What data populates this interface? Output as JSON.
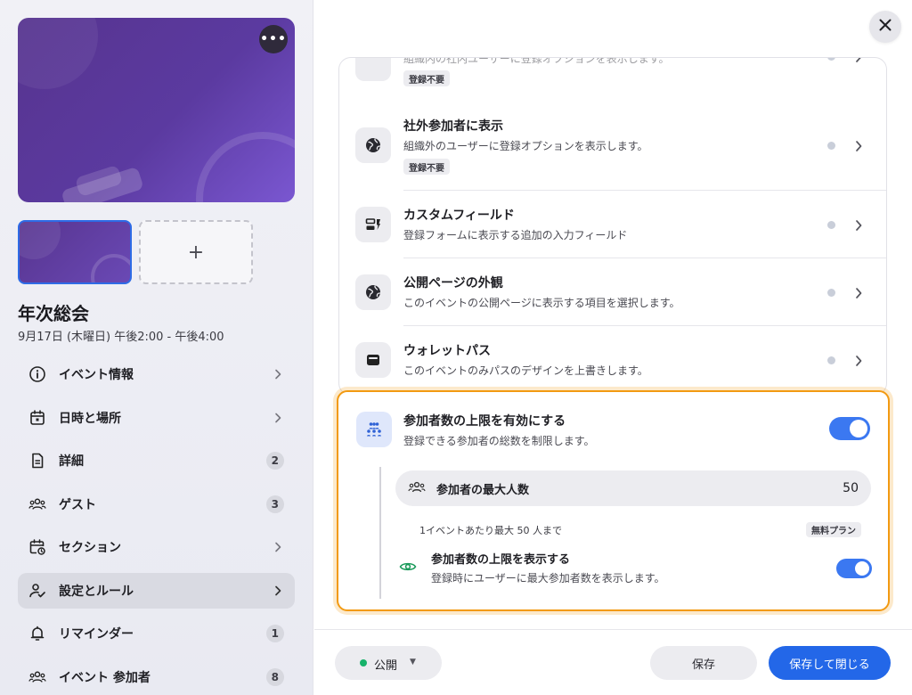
{
  "event": {
    "title": "年次総会",
    "date": "9月17日 (木曜日) 午後2:00 - 午後4:00",
    "add_thumb": "+",
    "more": "•••"
  },
  "nav": [
    {
      "label": "イベント情報",
      "icon": "info-icon",
      "trail": "chevron"
    },
    {
      "label": "日時と場所",
      "icon": "calendar-icon",
      "trail": "chevron"
    },
    {
      "label": "詳細",
      "icon": "document-icon",
      "trail": "badge",
      "badge": "2"
    },
    {
      "label": "ゲスト",
      "icon": "people-icon",
      "trail": "badge",
      "badge": "3"
    },
    {
      "label": "セクション",
      "icon": "calendar-clock-icon",
      "trail": "chevron"
    },
    {
      "label": "設定とルール",
      "icon": "person-check-icon",
      "trail": "chevron",
      "active": true
    },
    {
      "label": "リマインダー",
      "icon": "bell-icon",
      "trail": "badge",
      "badge": "1"
    },
    {
      "label": "イベント 参加者",
      "icon": "group-icon",
      "trail": "badge",
      "badge": "8"
    }
  ],
  "settings": {
    "partial_row": {
      "desc": "組織内の社内ユーザーに登録オプションを表示します。",
      "tag": "登録不要"
    },
    "rows": [
      {
        "title": "社外参加者に表示",
        "desc": "組織外のユーザーに登録オプションを表示します。",
        "tag": "登録不要",
        "icon": "globe-icon"
      },
      {
        "title": "カスタムフィールド",
        "desc": "登録フォームに表示する追加の入力フィールド",
        "icon": "form-fields-icon"
      },
      {
        "title": "公開ページの外観",
        "desc": "このイベントの公開ページに表示する項目を選択します。",
        "icon": "globe-icon"
      },
      {
        "title": "ウォレットパス",
        "desc": "このイベントのみパスのデザインを上書きします。",
        "icon": "wallet-icon"
      }
    ]
  },
  "capacity": {
    "title": "参加者数の上限を有効にする",
    "desc": "登録できる参加者の総数を制限します。",
    "enabled": true,
    "max_label": "参加者の最大人数",
    "max_value": "50",
    "note": "1イベントあたり最大 50 人まで",
    "plan_tag": "無料プラン",
    "show_title": "参加者数の上限を表示する",
    "show_desc": "登録時にユーザーに最大参加者数を表示します。",
    "show_enabled": true
  },
  "footer": {
    "status": "公開",
    "save": "保存",
    "save_close": "保存して閉じる"
  },
  "colors": {
    "accent": "#2367e8",
    "highlight": "#f29a12",
    "published": "#17b26a"
  }
}
